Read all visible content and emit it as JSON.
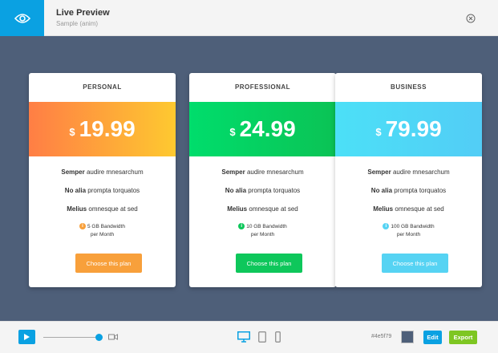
{
  "header": {
    "title": "Live Preview",
    "subtitle": "Sample (anim)",
    "eye_icon": "eye-icon",
    "close_icon": "close-circle-icon"
  },
  "plans": [
    {
      "name": "PERSONAL",
      "currency": "$",
      "price": "19.99",
      "gradient_from": "#ff7e45",
      "gradient_to": "#fec930",
      "accent": "#f8a03b",
      "features": [
        {
          "bold": "Semper",
          "rest": " audire mnesarchum"
        },
        {
          "bold": "No alia",
          "rest": " prompta torquatos"
        },
        {
          "bold": "Melius",
          "rest": " omnesque at sed"
        }
      ],
      "bandwidth_line1": "5 GB Bandwidth",
      "bandwidth_line2": "per Month",
      "button": "Choose this plan"
    },
    {
      "name": "PROFESSIONAL",
      "currency": "$",
      "price": "24.99",
      "gradient_from": "#00dd6c",
      "gradient_to": "#0bc355",
      "accent": "#0ec75b",
      "features": [
        {
          "bold": "Semper",
          "rest": " audire mnesarchum"
        },
        {
          "bold": "No alia",
          "rest": " prompta torquatos"
        },
        {
          "bold": "Melius",
          "rest": " omnesque at sed"
        }
      ],
      "bandwidth_line1": "10 GB Bandwidth",
      "bandwidth_line2": "per Month",
      "button": "Choose this plan"
    },
    {
      "name": "BUSINESS",
      "currency": "$",
      "price": "79.99",
      "gradient_from": "#4ce0f7",
      "gradient_to": "#52cdf6",
      "accent": "#56d3f3",
      "features": [
        {
          "bold": "Semper",
          "rest": " audire mnesarchum"
        },
        {
          "bold": "No alia",
          "rest": " prompta torquatos"
        },
        {
          "bold": "Melius",
          "rest": " omnesque at sed"
        }
      ],
      "bandwidth_line1": "100 GB Bandwidth",
      "bandwidth_line2": "per Month",
      "button": "Choose this plan"
    }
  ],
  "toolbar": {
    "play_icon": "play-icon",
    "camera_icon": "video-camera-icon",
    "devices": [
      "desktop-icon",
      "tablet-icon",
      "phone-icon"
    ],
    "active_device": "desktop-icon",
    "bg_color_hex": "#4e5f79",
    "edit_label": "Edit",
    "export_label": "Export"
  },
  "colors": {
    "canvas_bg": "#4e5f79",
    "accent_blue": "#0aa1e2",
    "export_green": "#7ec622"
  }
}
